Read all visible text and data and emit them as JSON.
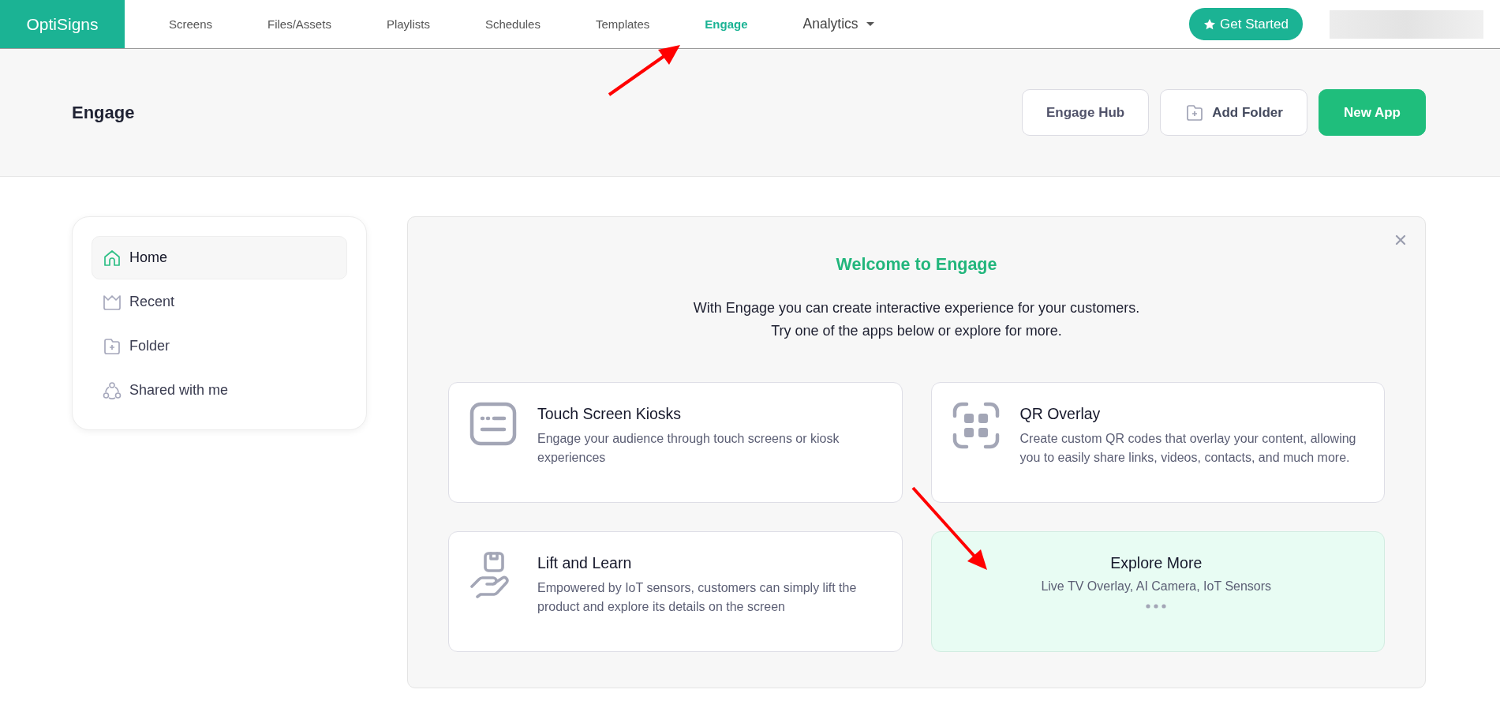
{
  "nav": {
    "logo": "OptiSigns",
    "items": [
      {
        "label": "Screens",
        "selected": false,
        "kind": "link"
      },
      {
        "label": "Files/Assets",
        "selected": false,
        "kind": "link"
      },
      {
        "label": "Playlists",
        "selected": false,
        "kind": "link"
      },
      {
        "label": "Schedules",
        "selected": false,
        "kind": "link"
      },
      {
        "label": "Templates",
        "selected": false,
        "kind": "link"
      },
      {
        "label": "Engage",
        "selected": true,
        "kind": "link"
      },
      {
        "label": "Analytics",
        "selected": false,
        "kind": "dropdown"
      }
    ],
    "get_started": "Get Started"
  },
  "header": {
    "title": "Engage",
    "buttons": [
      {
        "label": "Engage Hub",
        "kind": "secondary"
      },
      {
        "label": "Add Folder",
        "kind": "folder"
      },
      {
        "label": "New App",
        "kind": "primary"
      }
    ]
  },
  "sidebar": {
    "items": [
      {
        "label": "Home",
        "selected": true,
        "kind": "home"
      },
      {
        "label": "Recent",
        "selected": false,
        "kind": "recent"
      },
      {
        "label": "Folder",
        "selected": false,
        "kind": "folder"
      },
      {
        "label": "Shared with me",
        "selected": false,
        "kind": "shared"
      }
    ]
  },
  "welcome": {
    "title": "Welcome to Engage",
    "lines": [
      "With Engage you can create interactive experience for your customers.",
      "Try one of the apps below or explore for more."
    ],
    "cards": [
      {
        "kind": "kiosk",
        "title": "Touch Screen Kiosks",
        "description": "Engage your audience through touch screens or kiosk experiences"
      },
      {
        "kind": "qr",
        "title": "QR Overlay",
        "description": "Create custom QR codes that overlay your content, allowing you to easily share links, videos, contacts, and much more."
      },
      {
        "kind": "lift",
        "title": "Lift and Learn",
        "description": "Empowered by IoT sensors, customers can simply lift the product and explore its details on the screen"
      },
      {
        "kind": "explore",
        "title": "Explore More",
        "description": "Live TV Overlay, AI Camera, IoT Sensors"
      }
    ]
  }
}
